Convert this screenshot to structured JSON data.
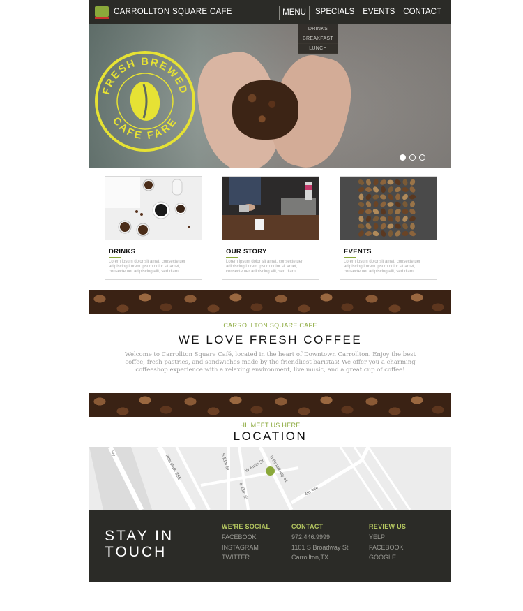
{
  "header": {
    "brand": "CARROLLTON SQUARE CAFE",
    "nav": [
      "MENU",
      "SPECIALS",
      "EVENTS",
      "CONTACT"
    ],
    "menu_dropdown": [
      "DRINKS",
      "BREAKFAST",
      "LUNCH"
    ]
  },
  "hero": {
    "seal_top": "FRESH BREWED",
    "seal_bottom": "CAFE FARE",
    "slides": 3,
    "active_slide": 1
  },
  "cards": [
    {
      "title": "DRINKS",
      "text": "Lorem ipsum dolor sit amet, consectetuer adipiscing Lorem ipsum dolor sit amet, consectetuer adipiscing elit, sed diam"
    },
    {
      "title": "OUR STORY",
      "text": "Lorem ipsum dolor sit amet, consectetuer adipiscing Lorem ipsum dolor sit amet, consectetuer adipiscing elit, sed diam"
    },
    {
      "title": "EVENTS",
      "text": "Lorem ipsum dolor sit amet, consectetuer adipiscing Lorem ipsum dolor sit amet, consectetuer adipiscing elit, sed diam"
    }
  ],
  "about": {
    "kicker": "CARROLLTON SQUARE CAFE",
    "title": "WE LOVE FRESH COFFEE",
    "text": "Welcome to Carrollton Square Café, located in the heart of Downtown Carrollton. Enjoy the best coffee, fresh pastries, and sandwiches made by the friendliest baristas! We offer you a charming coffeeshop experience with a relaxing environment, live music, and a great cup of coffee!"
  },
  "location": {
    "kicker": "HI, MEET US HERE",
    "title": "LOCATION",
    "streets": [
      "Interstate 35E",
      "S Elm St",
      "W Main St",
      "S Broadway St",
      "S Elm St",
      "4th Ave",
      "wy"
    ]
  },
  "footer": {
    "stay_line1": "STAY IN",
    "stay_line2": "TOUCH",
    "social": {
      "heading": "WE'RE SOCIAL",
      "items": [
        "FACEBOOK",
        "INSTAGRAM",
        "TWITTER"
      ]
    },
    "contact": {
      "heading": "CONTACT",
      "items": [
        "972.446.9999",
        "1101 S Broadway St",
        "Carrollton,TX"
      ]
    },
    "review": {
      "heading": "REVIEW US",
      "items": [
        "YELP",
        "FACEBOOK",
        "GOOGLE"
      ]
    }
  },
  "colors": {
    "accent": "#8aa83a",
    "dark": "#2b2b27",
    "seal_yellow": "#e6e234"
  }
}
